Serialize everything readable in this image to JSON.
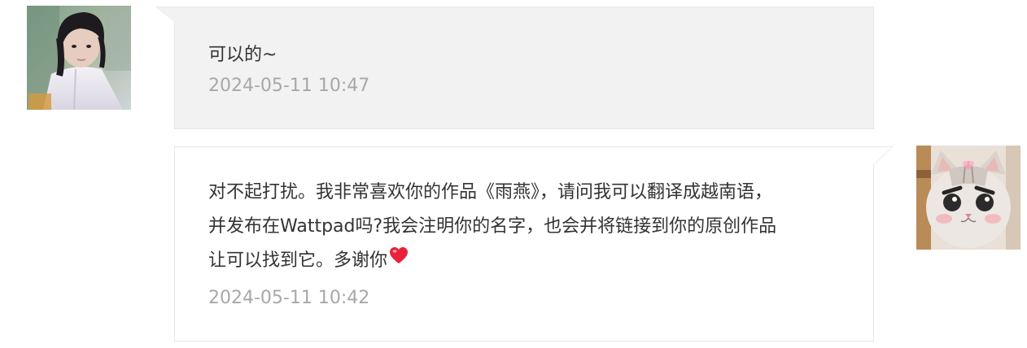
{
  "messages": [
    {
      "side": "left",
      "text": "可以的~",
      "time": "2024-05-11 10:47",
      "avatar": "user-photo-avatar"
    },
    {
      "side": "right",
      "lines": [
        "对不起打扰。我非常喜欢你的作品《雨燕》，请问我可以翻译成越南语，",
        "并发布在Wattpad吗?我会注明你的名字，也会并将链接到你的原创作品",
        "让可以找到它。多谢你"
      ],
      "emoji": "heart-icon",
      "time": "2024-05-11 10:42",
      "avatar": "cat-avatar"
    }
  ],
  "colors": {
    "bubble_left_bg": "#f2f2f2",
    "bubble_border": "#e6e6e6",
    "text": "#333333",
    "timestamp": "#a8a8a8",
    "heart": "#e8223a"
  }
}
